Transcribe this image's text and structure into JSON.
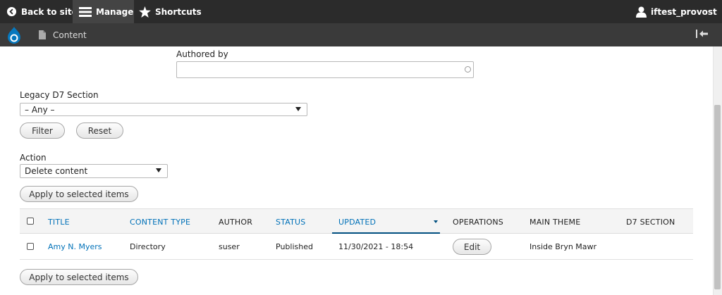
{
  "toolbar": {
    "back_to_site": "Back to site",
    "manage": "Manage",
    "shortcuts": "Shortcuts",
    "user": "iftest_provost"
  },
  "secondary": {
    "content": "Content"
  },
  "filters": {
    "authored_by_label": "Authored by",
    "authored_by_value": "",
    "legacy_label": "Legacy D7 Section",
    "legacy_value": "– Any –",
    "filter_button": "Filter",
    "reset_button": "Reset"
  },
  "action": {
    "label": "Action",
    "value": "Delete content",
    "apply_button": "Apply to selected items"
  },
  "table": {
    "headers": {
      "title": "TITLE",
      "content_type": "CONTENT TYPE",
      "author": "AUTHOR",
      "status": "STATUS",
      "updated": "UPDATED",
      "operations": "OPERATIONS",
      "main_theme": "MAIN THEME",
      "d7_section": "D7 SECTION"
    },
    "rows": [
      {
        "title": "Amy N. Myers",
        "content_type": "Directory",
        "author": "suser",
        "status": "Published",
        "updated": "11/30/2021 - 18:54",
        "operation": "Edit",
        "main_theme": "Inside Bryn Mawr",
        "d7_section": ""
      }
    ]
  },
  "bottom": {
    "apply_button": "Apply to selected items"
  },
  "colors": {
    "toolbar": "#2b2b2b",
    "link": "#0071b8",
    "sort": "#004f80"
  }
}
